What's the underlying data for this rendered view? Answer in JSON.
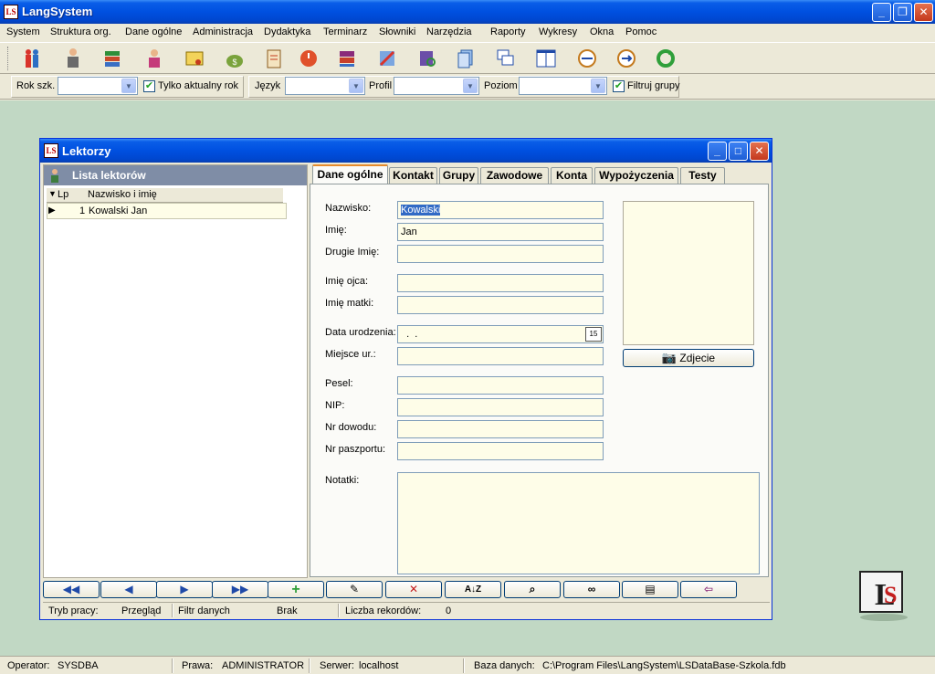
{
  "app": {
    "title": "LangSystem",
    "icon_text": "LS"
  },
  "menu": [
    "System",
    "Struktura org.",
    "Dane ogólne",
    "Administracja",
    "Dydaktyka",
    "Terminarz",
    "Słowniki",
    "Narzędzia",
    "Raporty",
    "Wykresy",
    "Okna",
    "Pomoc"
  ],
  "filters": {
    "rok_label": "Rok szk.",
    "only_current_label": "Tylko aktualny rok",
    "language_label": "Język",
    "profile_label": "Profil",
    "level_label": "Poziom",
    "filter_groups_label": "Filtruj grupy"
  },
  "child": {
    "title": "Lektorzy",
    "list_header": "Lista lektorów",
    "columns": [
      "Lp",
      "Nazwisko i imię"
    ],
    "rows": [
      {
        "lp": "1",
        "name": "Kowalski Jan"
      }
    ],
    "tabs": [
      "Dane ogólne",
      "Kontakt",
      "Grupy",
      "Zawodowe",
      "Konta",
      "Wypożyczenia",
      "Testy"
    ],
    "form": {
      "nazwisko_label": "Nazwisko:",
      "nazwisko_value": "Kowalski",
      "imie_label": "Imię:",
      "imie_value": "Jan",
      "drugie_label": "Drugie Imię:",
      "ojca_label": "Imię ojca:",
      "matki_label": "Imię matki:",
      "data_label": "Data urodzenia:",
      "data_value": "  .  .",
      "miejsce_label": "Miejsce ur.:",
      "pesel_label": "Pesel:",
      "nip_label": "NIP:",
      "dowod_label": "Nr dowodu:",
      "paszport_label": "Nr paszportu:",
      "notatki_label": "Notatki:"
    },
    "photo_button": "Zdjecie",
    "status": {
      "mode_label": "Tryb pracy:",
      "mode_value": "Przegląd",
      "filter_label": "Filtr danych",
      "filter_value": "Brak",
      "count_label": "Liczba rekordów:",
      "count_value": "0"
    }
  },
  "statusbar": {
    "operator_label": "Operator:",
    "operator_value": "SYSDBA",
    "rights_label": "Prawa:",
    "rights_value": "ADMINISTRATOR",
    "server_label": "Serwer:",
    "server_value": "localhost",
    "db_label": "Baza danych:",
    "db_value": "C:\\Program Files\\LangSystem\\LSDataBase-Szkola.fdb"
  },
  "colors": {
    "desktop": "#c1d8c4",
    "input_bg": "#fefde8",
    "title_blue": "#0050e0",
    "tab_accent": "#e68b2c"
  }
}
